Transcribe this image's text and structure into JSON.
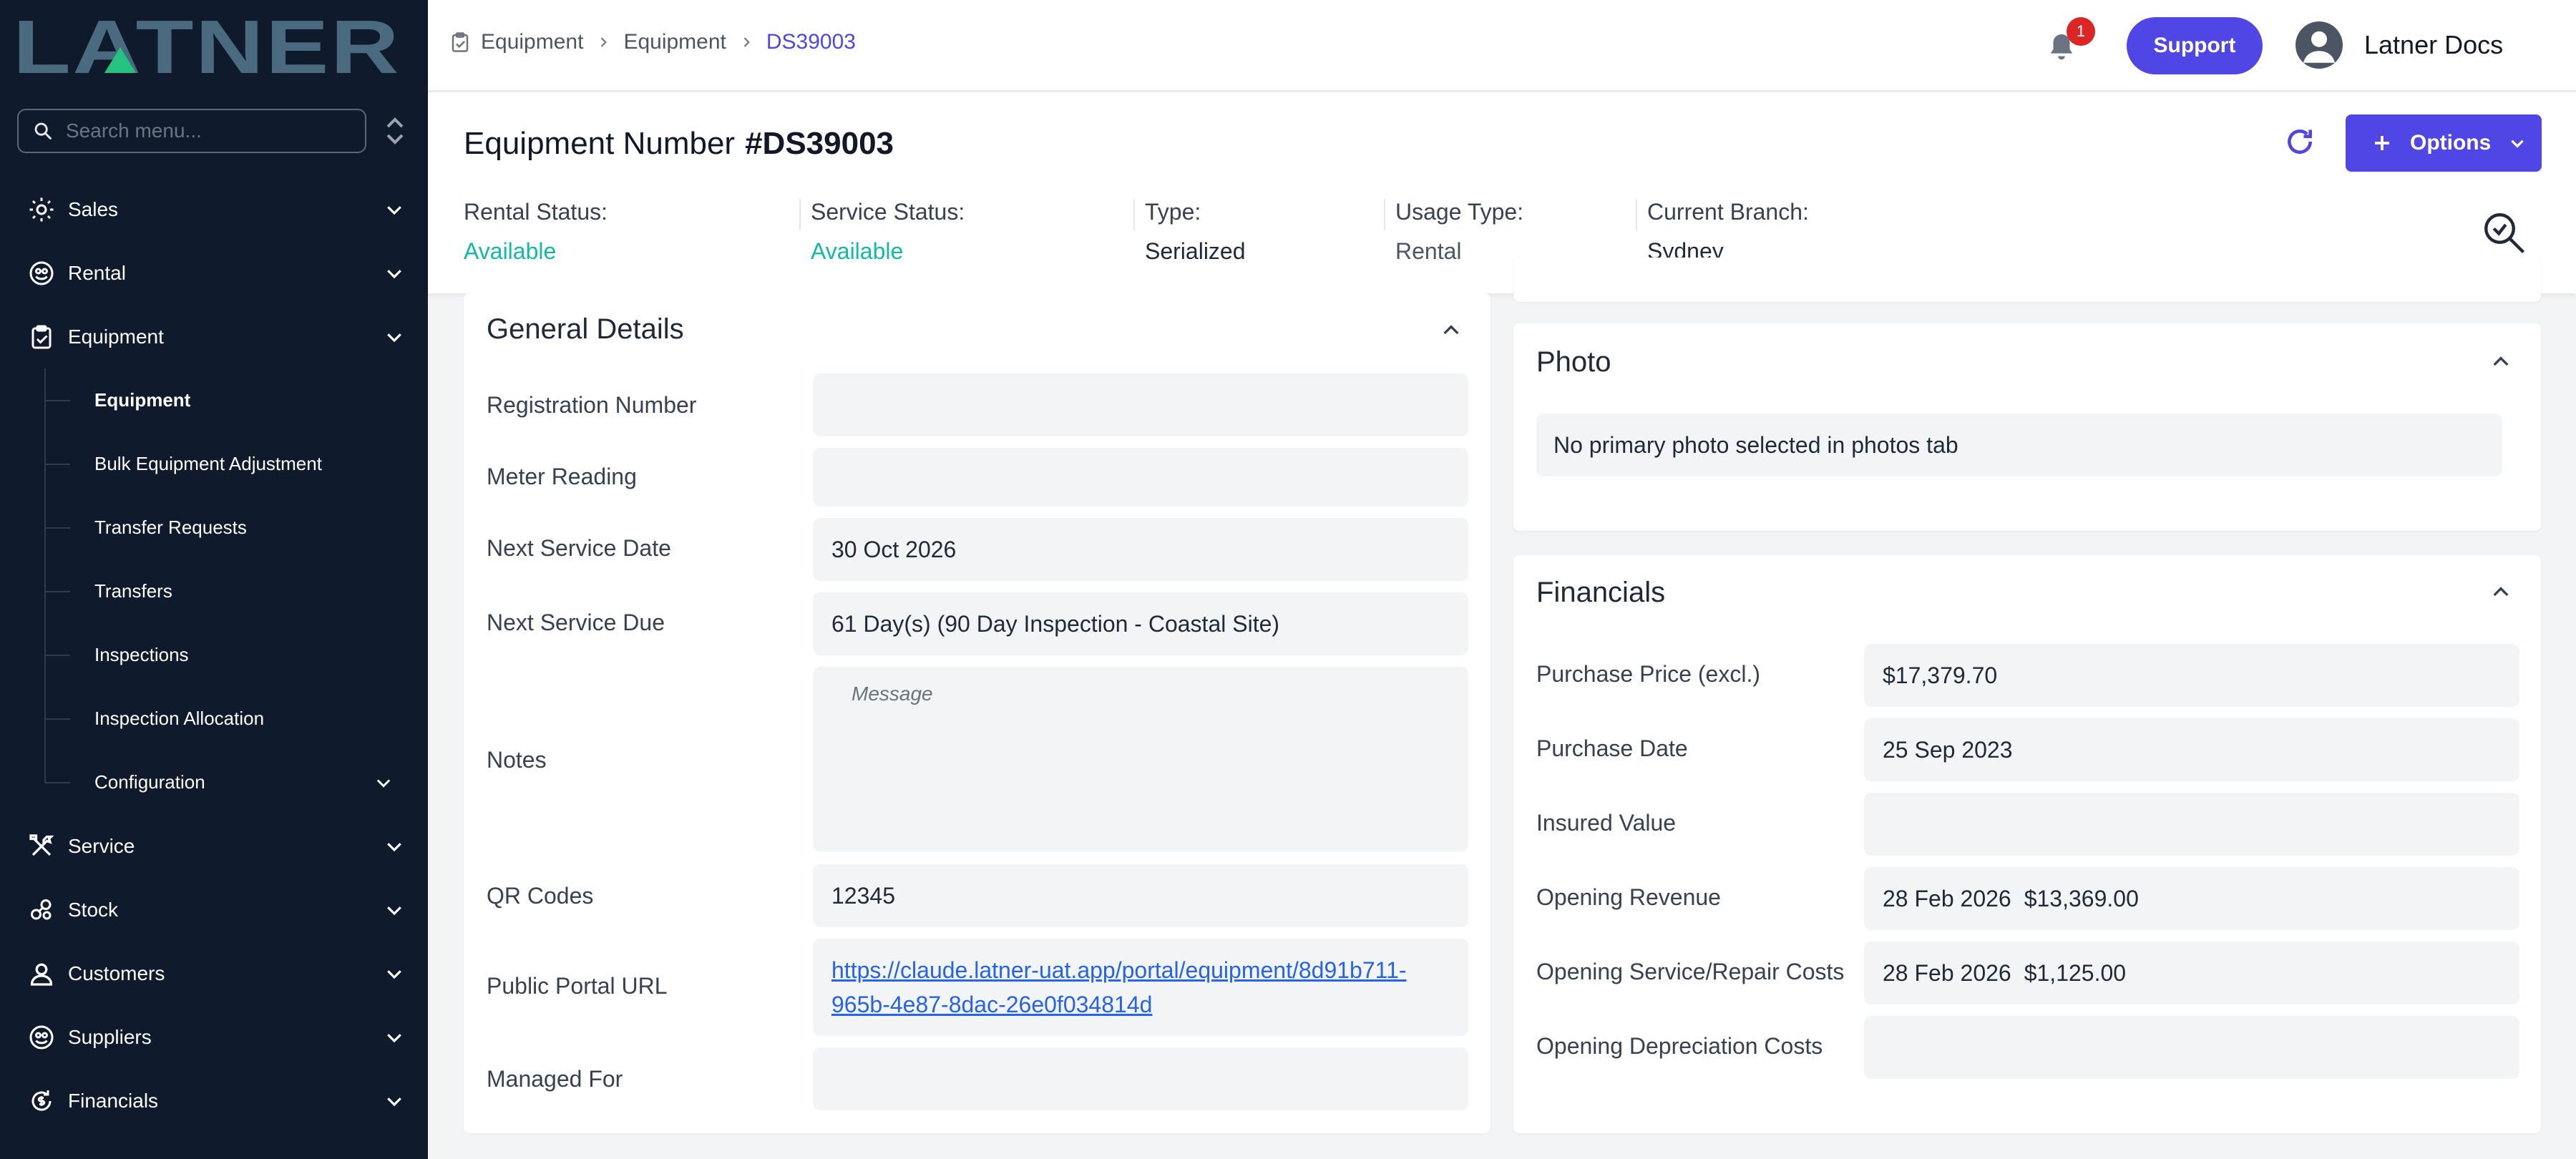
{
  "app": {
    "logo_text": "LATNER",
    "colors": {
      "sidebar_bg": "#0f1b2d",
      "accent": "#4f46e5",
      "status_green": "#14b8a6",
      "logo_blue": "#4a6a80",
      "logo_green": "#26c281"
    }
  },
  "sidebar": {
    "search_placeholder": "Search menu...",
    "items": [
      {
        "label": "Sales",
        "icon": "sales-sun-icon"
      },
      {
        "label": "Rental",
        "icon": "rental-icon"
      },
      {
        "label": "Equipment",
        "icon": "clipboard-check-icon"
      },
      {
        "label": "Service",
        "icon": "tools-icon"
      },
      {
        "label": "Stock",
        "icon": "stock-icon"
      },
      {
        "label": "Customers",
        "icon": "user-icon"
      },
      {
        "label": "Suppliers",
        "icon": "suppliers-icon"
      },
      {
        "label": "Financials",
        "icon": "financials-icon"
      }
    ],
    "equipment_sub": [
      {
        "label": "Equipment",
        "active": true
      },
      {
        "label": "Bulk Equipment Adjustment"
      },
      {
        "label": "Transfer Requests"
      },
      {
        "label": "Transfers"
      },
      {
        "label": "Inspections"
      },
      {
        "label": "Inspection Allocation"
      },
      {
        "label": "Configuration"
      }
    ]
  },
  "topbar": {
    "breadcrumbs": [
      "Equipment",
      "Equipment",
      "DS39003"
    ],
    "notification_count": "1",
    "support_label": "Support",
    "user_name": "Latner Docs"
  },
  "header": {
    "title_label": "Equipment Number",
    "title_number": "#DS39003",
    "options_label": "Options",
    "statuses": [
      {
        "label": "Rental Status:",
        "value": "Available"
      },
      {
        "label": "Service Status:",
        "value": "Available"
      },
      {
        "label": "Type:",
        "value": "Serialized"
      },
      {
        "label": "Usage Type:",
        "value": "Rental"
      },
      {
        "label": "Current Branch:",
        "value": "Sydney"
      }
    ]
  },
  "general": {
    "title": "General Details",
    "rows": [
      {
        "label": "Registration Number",
        "value": ""
      },
      {
        "label": "Meter Reading",
        "value": ""
      },
      {
        "label": "Next Service Date",
        "value": "30 Oct 2026"
      },
      {
        "label": "Next Service Due",
        "value": "61 Day(s) (90 Day Inspection - Coastal Site)"
      },
      {
        "label": "Notes",
        "placeholder": "Message"
      },
      {
        "label": "QR Codes",
        "value": "12345"
      },
      {
        "label": "Public Portal URL",
        "value": "https://claude.latner-uat.app/portal/equipment/8d91b711-965b-4e87-8dac-26e0f034814d"
      },
      {
        "label": "Managed For",
        "value": ""
      }
    ]
  },
  "photo": {
    "title": "Photo",
    "message": "No primary photo selected in photos tab"
  },
  "financials": {
    "title": "Financials",
    "rows": [
      {
        "label": "Purchase Price (excl.)",
        "value": "$17,379.70"
      },
      {
        "label": "Purchase Date",
        "value": "25 Sep 2023"
      },
      {
        "label": "Insured Value",
        "value": ""
      },
      {
        "label": "Opening Revenue",
        "date": "28 Feb 2026",
        "amount": "$13,369.00"
      },
      {
        "label": "Opening Service/Repair Costs",
        "date": "28 Feb 2026",
        "amount": "$1,125.00"
      },
      {
        "label": "Opening Depreciation Costs",
        "value": ""
      }
    ]
  }
}
